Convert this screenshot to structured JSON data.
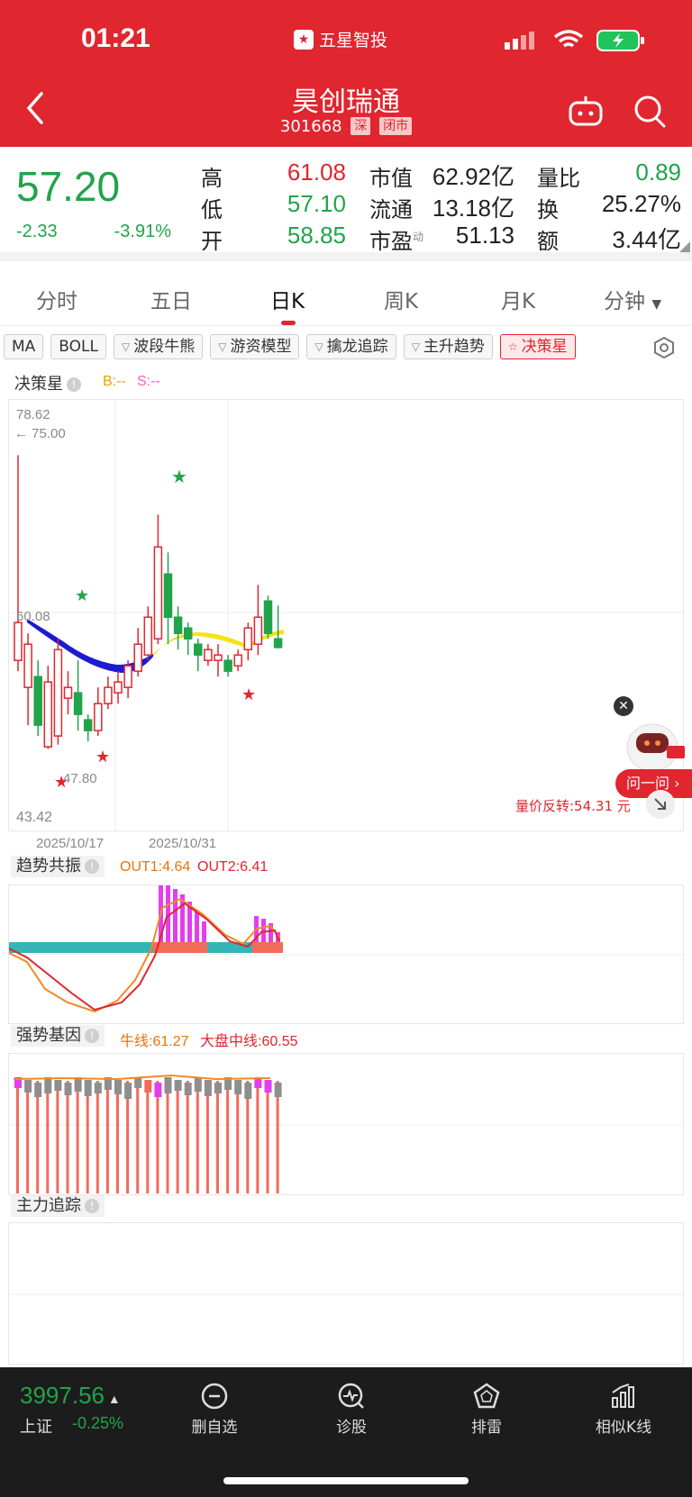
{
  "status": {
    "time": "01:21",
    "app_name": "五星智投"
  },
  "header": {
    "name": "昊创瑞通",
    "code": "301668",
    "exchange": "深",
    "market_state": "闭市"
  },
  "quote": {
    "price": "57.20",
    "change": "-2.33",
    "change_pct": "-3.91%",
    "rows": [
      {
        "k1": "高",
        "v1": "61.08",
        "k2": "市值",
        "v2": "62.92亿",
        "k3": "量比",
        "v3": "0.89"
      },
      {
        "k1": "低",
        "v1": "57.10",
        "k2": "流通",
        "v2": "13.18亿",
        "k3": "换",
        "v3": "25.27%"
      },
      {
        "k1": "开",
        "v1": "58.85",
        "k2": "市盈",
        "k2sup": "动",
        "v2": "51.13",
        "k3": "额",
        "v3": "3.44亿"
      }
    ],
    "colors": {
      "up": "#e0262f",
      "down": "#21a44a"
    }
  },
  "tabs": [
    "分时",
    "五日",
    "日K",
    "周K",
    "月K",
    "分钟"
  ],
  "active_tab": "日K",
  "indicators": [
    "MA",
    "BOLL",
    "波段牛熊",
    "游资模型",
    "擒龙追踪",
    "主升趋势",
    "决策星"
  ],
  "main_chart": {
    "title": "决策星",
    "legend_b": "B:--",
    "legend_s": "S:--",
    "y_max": "78.62",
    "mark_high": "← 75.00",
    "mark_mid": "60.08",
    "mark_low": "47.80",
    "y_min": "43.42",
    "date1": "2025/10/17",
    "date2": "2025/10/31",
    "note": "量价反转:54.31 元"
  },
  "chart_data": {
    "type": "candlestick",
    "ylim": [
      43.42,
      78.62
    ],
    "candles": [
      {
        "o": 56.0,
        "c": 59.5,
        "h": 75.0,
        "l": 55.0,
        "up": true
      },
      {
        "o": 57.5,
        "c": 53.5,
        "h": 58.5,
        "l": 50.0,
        "up": true
      },
      {
        "o": 50.0,
        "c": 54.5,
        "h": 56.0,
        "l": 49.0,
        "up": false
      },
      {
        "o": 54.0,
        "c": 48.0,
        "h": 55.5,
        "l": 47.8,
        "up": true
      },
      {
        "o": 49.0,
        "c": 57.0,
        "h": 58.0,
        "l": 48.2,
        "up": true
      },
      {
        "o": 53.5,
        "c": 52.5,
        "h": 55.0,
        "l": 51.0,
        "up": true
      },
      {
        "o": 53.0,
        "c": 51.0,
        "h": 56.0,
        "l": 49.5,
        "up": false
      },
      {
        "o": 50.5,
        "c": 49.5,
        "h": 51.0,
        "l": 48.5,
        "up": false
      },
      {
        "o": 49.5,
        "c": 52.0,
        "h": 53.5,
        "l": 49.0,
        "up": true
      },
      {
        "o": 52.0,
        "c": 53.5,
        "h": 54.5,
        "l": 51.5,
        "up": true
      },
      {
        "o": 53.0,
        "c": 54.0,
        "h": 55.0,
        "l": 52.0,
        "up": true
      },
      {
        "o": 53.5,
        "c": 55.5,
        "h": 56.0,
        "l": 52.5,
        "up": true
      },
      {
        "o": 55.0,
        "c": 57.5,
        "h": 59.0,
        "l": 54.5,
        "up": true
      },
      {
        "o": 56.5,
        "c": 60.0,
        "h": 61.0,
        "l": 56.0,
        "up": true
      },
      {
        "o": 58.0,
        "c": 66.5,
        "h": 69.5,
        "l": 57.5,
        "up": true
      },
      {
        "o": 64.0,
        "c": 60.0,
        "h": 66.0,
        "l": 57.5,
        "up": false
      },
      {
        "o": 60.0,
        "c": 58.5,
        "h": 61.0,
        "l": 57.0,
        "up": false
      },
      {
        "o": 59.0,
        "c": 58.0,
        "h": 59.5,
        "l": 56.5,
        "up": false
      },
      {
        "o": 57.5,
        "c": 56.5,
        "h": 58.0,
        "l": 55.0,
        "up": false
      },
      {
        "o": 56.0,
        "c": 57.0,
        "h": 57.5,
        "l": 55.5,
        "up": true
      },
      {
        "o": 56.5,
        "c": 56.0,
        "h": 57.5,
        "l": 54.5,
        "up": true
      },
      {
        "o": 56.0,
        "c": 55.0,
        "h": 56.5,
        "l": 54.5,
        "up": false
      },
      {
        "o": 55.5,
        "c": 56.5,
        "h": 57.0,
        "l": 55.0,
        "up": true
      },
      {
        "o": 57.0,
        "c": 59.0,
        "h": 59.5,
        "l": 56.0,
        "up": true
      },
      {
        "o": 57.5,
        "c": 60.0,
        "h": 63.0,
        "l": 56.5,
        "up": true
      },
      {
        "o": 61.5,
        "c": 58.5,
        "h": 62.0,
        "l": 58.0,
        "up": false
      },
      {
        "o": 58.0,
        "c": 57.2,
        "h": 61.08,
        "l": 57.1,
        "up": false
      }
    ]
  },
  "trend_panel": {
    "title": "趋势共振",
    "out1": "OUT1:4.64",
    "out2": "OUT2:6.41"
  },
  "strength_panel": {
    "title": "强势基因",
    "bull": "牛线:61.27",
    "market": "大盘中线:60.55"
  },
  "main_force_panel": {
    "title": "主力追踪"
  },
  "float": {
    "close": "✕",
    "ask": "问一问"
  },
  "bottom": {
    "index_value": "3997.56",
    "index_name": "上证",
    "index_change": "-0.25%",
    "nav": [
      "删自选",
      "诊股",
      "排雷",
      "相似K线"
    ]
  }
}
